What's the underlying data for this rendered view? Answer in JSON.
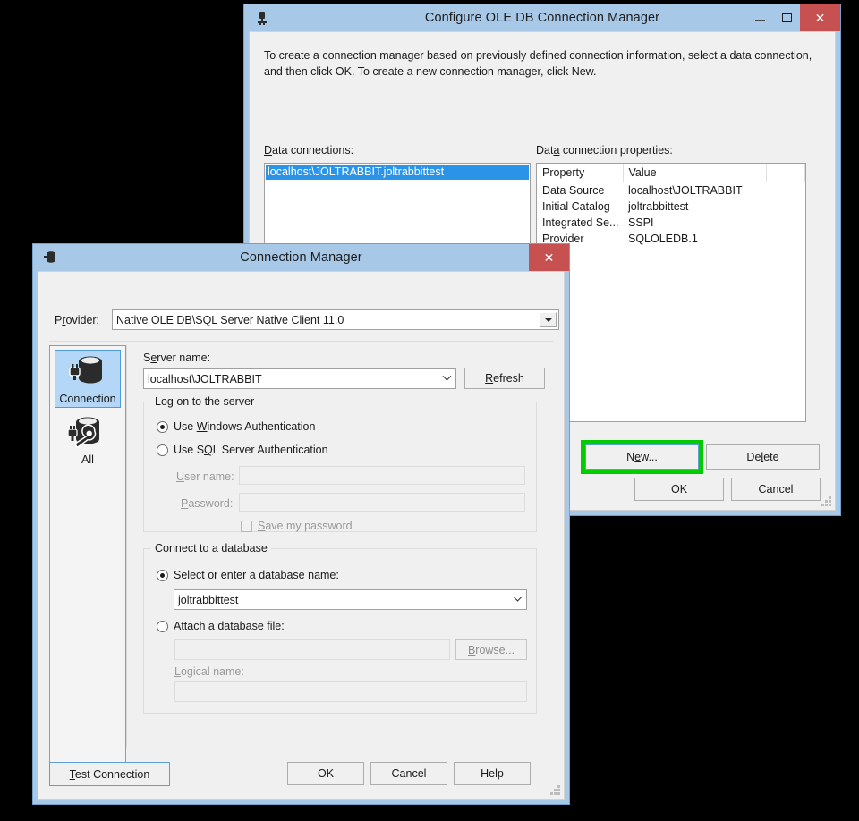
{
  "configure_dialog": {
    "title": "Configure OLE DB Connection Manager",
    "icon": "server-plug-icon",
    "window_buttons": {
      "minimize": "minimize-icon",
      "maximize": "maximize-icon",
      "close": "✕"
    },
    "instructions": "To create a connection manager based on previously defined connection information, select a data connection, and then click OK. To create a new connection manager, click New.",
    "data_connections_label": "Data connections:",
    "data_connections_accel": "D",
    "data_connections": [
      {
        "label": "localhost\\JOLTRABBIT.joltrabbittest",
        "selected": true
      }
    ],
    "properties_label": "Data connection properties:",
    "properties_accel": "a",
    "properties_table": {
      "columns": [
        "Property",
        "Value",
        ""
      ],
      "rows": [
        {
          "property": "Data Source",
          "value": "localhost\\JOLTRABBIT"
        },
        {
          "property": "Initial Catalog",
          "value": "joltrabbittest"
        },
        {
          "property": "Integrated Se...",
          "value": "SSPI"
        },
        {
          "property": "Provider",
          "value": "SQLOLEDB.1"
        }
      ]
    },
    "buttons": {
      "new": "New...",
      "delete": "Delete",
      "ok": "OK",
      "cancel": "Cancel"
    },
    "highlight": {
      "target": "new-button",
      "color": "#00cc00"
    }
  },
  "connection_manager_dialog": {
    "title": "Connection Manager",
    "icon": "database-icon",
    "window_buttons": {
      "close": "✕"
    },
    "provider_label": "Provider:",
    "provider_value": "Native OLE DB\\SQL Server Native Client 11.0",
    "rail": [
      {
        "label": "Connection",
        "icon": "database-plug-icon",
        "active": true
      },
      {
        "label": "All",
        "icon": "database-wrench-icon",
        "active": false
      }
    ],
    "server_name_label": "Server name:",
    "server_name_value": "localhost\\JOLTRABBIT",
    "refresh_button": "Refresh",
    "logon_group": {
      "title": "Log on to the server",
      "options": [
        {
          "label": "Use Windows Authentication",
          "checked": true
        },
        {
          "label": "Use SQL Server Authentication",
          "checked": false
        }
      ],
      "user_name_label": "User name:",
      "user_name_value": "",
      "password_label": "Password:",
      "password_value": "",
      "save_password_label": "Save my password",
      "save_password_checked": false
    },
    "database_group": {
      "title": "Connect to a database",
      "select_option_label": "Select or enter a database name:",
      "select_option_checked": true,
      "database_value": "joltrabbittest",
      "attach_option_label": "Attach a database file:",
      "attach_option_checked": false,
      "attach_file_value": "",
      "browse_button": "Browse...",
      "logical_name_label": "Logical name:",
      "logical_name_value": ""
    },
    "buttons": {
      "test_connection": "Test Connection",
      "ok": "OK",
      "cancel": "Cancel",
      "help": "Help"
    }
  },
  "colors": {
    "titlebar": "#a8c8e8",
    "close_button": "#c75050",
    "selection": "#2a94e8",
    "highlight": "#00cc00",
    "dialog_face": "#f0f0f0"
  }
}
